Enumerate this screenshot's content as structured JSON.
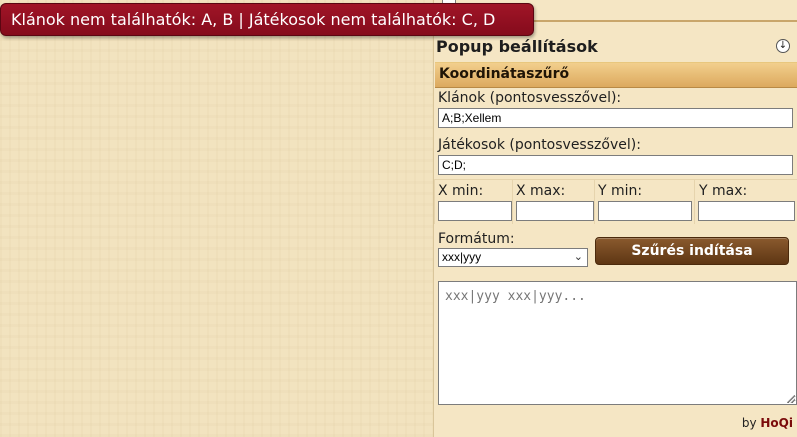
{
  "toast": {
    "message": "Klánok nem találhatók: A, B | Játékosok nem találhatók: C, D"
  },
  "panel": {
    "popup_title": "Popup beállítások",
    "section_title": "Koordinátaszűrő",
    "clans": {
      "label": "Klánok (pontosvesszővel):",
      "value": "A;B;Xellem"
    },
    "players": {
      "label": "Játékosok (pontosvesszővel):",
      "value": "C;D;"
    },
    "coords": {
      "x_min_label": "X min:",
      "x_max_label": "X max:",
      "y_min_label": "Y min:",
      "y_max_label": "Y max:",
      "x_min_value": "",
      "x_max_value": "",
      "y_min_value": "",
      "y_max_value": ""
    },
    "format": {
      "label": "Formátum:",
      "selected": "xxx|yyy"
    },
    "filter_button": "Szűrés indítása",
    "output": {
      "placeholder": "xxx|yyy xxx|yyy...",
      "value": ""
    },
    "footer": {
      "by": "by",
      "author": "HoQi"
    }
  },
  "colors": {
    "toast_bg": "#950f22",
    "section_bar": "#e2b46a",
    "button_bg": "#6e4420",
    "panel_bg": "#f5e6c4"
  },
  "icons": {
    "collapse": "arrow-down-icon",
    "dropdown": "chevron-down-icon"
  }
}
